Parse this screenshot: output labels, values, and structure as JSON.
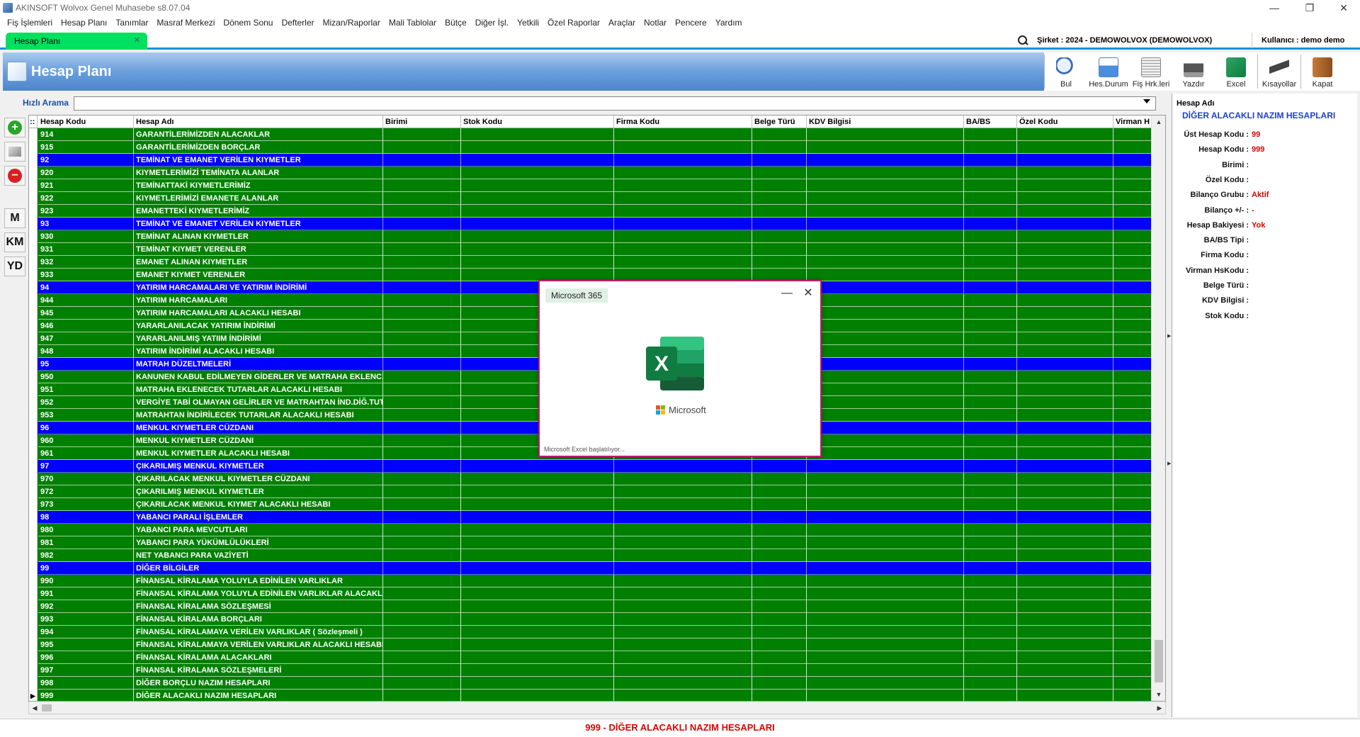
{
  "window": {
    "title": "AKINSOFT Wolvox Genel Muhasebe s8.07.04",
    "controls": {
      "minimize": "—",
      "restore": "❐",
      "close": "✕"
    }
  },
  "menu": [
    "Fiş İşlemleri",
    "Hesap Planı",
    "Tanımlar",
    "Masraf Merkezi",
    "Dönem Sonu",
    "Defterler",
    "Mizan/Raporlar",
    "Mali Tablolar",
    "Bütçe",
    "Diğer İşl.",
    "Yetkili",
    "Özel Raporlar",
    "Araçlar",
    "Notlar",
    "Pencere",
    "Yardım"
  ],
  "tab": {
    "label": "Hesap Planı",
    "close": "✕"
  },
  "company": "Şirket : 2024 - DEMOWOLVOX (DEMOWOLVOX)",
  "user": "Kullanıcı : demo demo",
  "header": {
    "title": "Hesap Planı"
  },
  "toolbar": {
    "bul": "Bul",
    "hesdurum": "Hes.Durum",
    "fishrk": "Fiş Hrk.leri",
    "yazdir": "Yazdır",
    "excel": "Excel",
    "kisayollar": "Kısayollar",
    "kapat": "Kapat"
  },
  "quick_search": {
    "label": "Hızlı Arama",
    "value": ""
  },
  "left_toolbar": {
    "m": "M",
    "km": "KM",
    "yd": "YD",
    "add": "+",
    "delete": "−"
  },
  "grid": {
    "columns": [
      "Hesap Kodu",
      "Hesap Adı",
      "Birimi",
      "Stok Kodu",
      "Firma Kodu",
      "Belge Türü",
      "KDV Bilgisi",
      "BA/BS",
      "Özel Kodu",
      "Virman H"
    ],
    "rows": [
      {
        "code": "914",
        "name": "GARANTİLERİMİZDEN ALACAKLAR",
        "group": false
      },
      {
        "code": "915",
        "name": "GARANTİLERİMİZDEN BORÇLAR",
        "group": false
      },
      {
        "code": "92",
        "name": "TEMİNAT VE EMANET VERİLEN KIYMETLER",
        "group": true
      },
      {
        "code": "920",
        "name": "KIYMETLERİMİZİ TEMİNATA ALANLAR",
        "group": false
      },
      {
        "code": "921",
        "name": "TEMİNATTAKİ KIYMETLERİMİZ",
        "group": false
      },
      {
        "code": "922",
        "name": "KIYMETLERİMİZİ EMANETE ALANLAR",
        "group": false
      },
      {
        "code": "923",
        "name": "EMANETTEKİ KIYMETLERİMİZ",
        "group": false
      },
      {
        "code": "93",
        "name": "TEMİNAT VE EMANET VERİLEN KIYMETLER",
        "group": true
      },
      {
        "code": "930",
        "name": "TEMİNAT ALINAN KIYMETLER",
        "group": false
      },
      {
        "code": "931",
        "name": "TEMİNAT KIYMET VERENLER",
        "group": false
      },
      {
        "code": "932",
        "name": "EMANET ALINAN KIYMETLER",
        "group": false
      },
      {
        "code": "933",
        "name": "EMANET KIYMET VERENLER",
        "group": false
      },
      {
        "code": "94",
        "name": "YATIRIM HARCAMALARI VE YATIRIM İNDİRİMİ",
        "group": true
      },
      {
        "code": "944",
        "name": "YATIRIM HARCAMALARI",
        "group": false
      },
      {
        "code": "945",
        "name": "YATIRIM HARCAMALARI ALACAKLI HESABI",
        "group": false
      },
      {
        "code": "946",
        "name": "YARARLANILACAK YATIRIM İNDİRİMİ",
        "group": false
      },
      {
        "code": "947",
        "name": "YARARLANILMIŞ YATIIM İNDİRİMİ",
        "group": false
      },
      {
        "code": "948",
        "name": "YATIRIM İNDİRİMİ ALACAKLI HESABI",
        "group": false
      },
      {
        "code": "95",
        "name": "MATRAH DÜZELTMELERİ",
        "group": true
      },
      {
        "code": "950",
        "name": "KANUNEN KABUL EDİLMEYEN GİDERLER VE MATRAHA EKLENC. DİĞ.TUTARLAR",
        "group": false
      },
      {
        "code": "951",
        "name": "MATRAHA EKLENECEK TUTARLAR ALACAKLI HESABI",
        "group": false
      },
      {
        "code": "952",
        "name": "VERGİYE TABİ OLMAYAN GELİRLER VE MATRAHTAN İND.DİĞ.TUTARLAR",
        "group": false
      },
      {
        "code": "953",
        "name": "MATRAHTAN İNDİRİLECEK TUTARLAR ALACAKLI HESABI",
        "group": false
      },
      {
        "code": "96",
        "name": "MENKUL KIYMETLER CÜZDANI",
        "group": true
      },
      {
        "code": "960",
        "name": "MENKUL KIYMETLER CÜZDANI",
        "group": false
      },
      {
        "code": "961",
        "name": "MENKUL KIYMETLER ALACAKLI HESABI",
        "group": false
      },
      {
        "code": "97",
        "name": "ÇIKARILMIŞ MENKUL KIYMETLER",
        "group": true
      },
      {
        "code": "970",
        "name": "ÇIKARILACAK MENKUL KIYMETLER CÜZDANI",
        "group": false
      },
      {
        "code": "972",
        "name": "ÇIKARILMIŞ MENKUL KIYMETLER",
        "group": false
      },
      {
        "code": "973",
        "name": "ÇIKARILACAK MENKUL KIYMET ALACAKLI HESABI",
        "group": false
      },
      {
        "code": "98",
        "name": "YABANCI PARALI İŞLEMLER",
        "group": true
      },
      {
        "code": "980",
        "name": "YABANCI PARA MEVCUTLARI",
        "group": false
      },
      {
        "code": "981",
        "name": "YABANCI PARA YÜKÜMLÜLÜKLERİ",
        "group": false
      },
      {
        "code": "982",
        "name": "NET YABANCI PARA VAZİYETİ",
        "group": false
      },
      {
        "code": "99",
        "name": "DİĞER BİLGİLER",
        "group": true
      },
      {
        "code": "990",
        "name": "FİNANSAL KİRALAMA YOLUYLA EDİNİLEN VARLIKLAR",
        "group": false
      },
      {
        "code": "991",
        "name": "FİNANSAL KİRALAMA YOLUYLA EDİNİLEN VARLIKLAR ALACAKLI HESABI",
        "group": false
      },
      {
        "code": "992",
        "name": "FİNANSAL KİRALAMA SÖZLEŞMESİ",
        "group": false
      },
      {
        "code": "993",
        "name": "FİNANSAL KİRALAMA BORÇLARI",
        "group": false
      },
      {
        "code": "994",
        "name": "FİNANSAL KİRALAMAYA VERİLEN VARLIKLAR ( Sözleşmeli )",
        "group": false
      },
      {
        "code": "995",
        "name": "FİNANSAL KİRALAMAYA VERİLEN VARLIKLAR ALACAKLI HESABI",
        "group": false
      },
      {
        "code": "996",
        "name": "FİNANSAL KİRALAMA ALACAKLARI",
        "group": false
      },
      {
        "code": "997",
        "name": "FİNANSAL KİRALAMA SÖZLEŞMELERİ",
        "group": false
      },
      {
        "code": "998",
        "name": "DİĞER BORÇLU NAZIM HESAPLARI",
        "group": false
      },
      {
        "code": "999",
        "name": "DİĞER ALACAKLI NAZIM HESAPLARI",
        "group": false
      }
    ]
  },
  "detail": {
    "label": "Hesap Adı",
    "name": "DİĞER ALACAKLI NAZIM HESAPLARI",
    "fields": [
      {
        "key": "Üst Hesap Kodu :",
        "value": "99"
      },
      {
        "key": "Hesap Kodu :",
        "value": "999"
      },
      {
        "key": "Birimi :",
        "value": ""
      },
      {
        "key": "Özel Kodu :",
        "value": ""
      },
      {
        "key": "Bilanço Grubu :",
        "value": "Aktif"
      },
      {
        "key": "Bilanço +/- :",
        "value": "-"
      },
      {
        "key": "Hesap Bakiyesi :",
        "value": "Yok"
      },
      {
        "key": "BA/BS Tipi :",
        "value": ""
      },
      {
        "key": "Firma Kodu :",
        "value": ""
      },
      {
        "key": "Virman HsKodu :",
        "value": ""
      },
      {
        "key": "Belge Türü :",
        "value": ""
      },
      {
        "key": "KDV Bilgisi :",
        "value": ""
      },
      {
        "key": "Stok Kodu :",
        "value": ""
      }
    ]
  },
  "status": "999 - DİĞER ALACAKLI NAZIM HESAPLARI",
  "splash": {
    "tag": "Microsoft 365",
    "brand": "Microsoft",
    "status": "Microsoft Excel başlatılıyor...",
    "minimize": "—",
    "close": "✕"
  },
  "colors": {
    "group_row": "#0000ff",
    "leaf_row": "#008000",
    "accent": "#1e90d8",
    "status_text": "#e00000"
  }
}
